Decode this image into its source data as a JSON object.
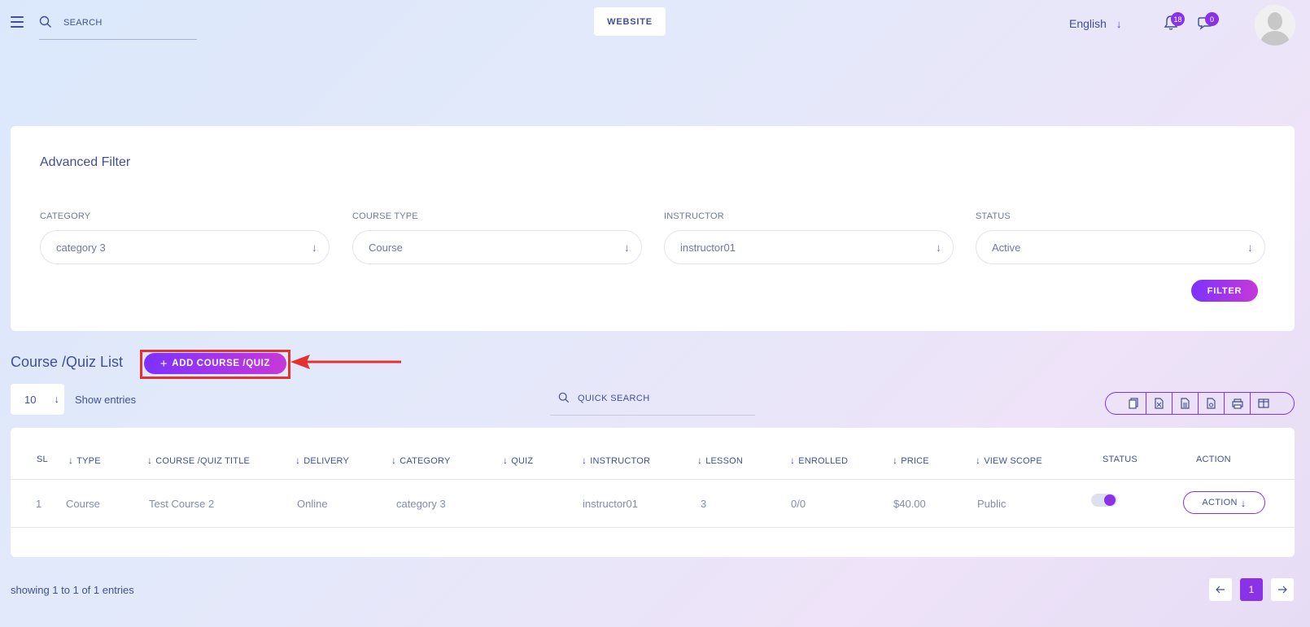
{
  "header": {
    "search_placeholder": "SEARCH",
    "website_label": "WEBSITE",
    "language": "English",
    "notification_count": "18",
    "message_count": "0"
  },
  "filter": {
    "title": "Advanced Filter",
    "fields": [
      {
        "label": "CATEGORY",
        "value": "category 3"
      },
      {
        "label": "COURSE TYPE",
        "value": "Course"
      },
      {
        "label": "INSTRUCTOR",
        "value": "instructor01"
      },
      {
        "label": "STATUS",
        "value": "Active"
      }
    ],
    "button_label": "FILTER"
  },
  "list": {
    "title": "Course /Quiz List",
    "add_label": "ADD COURSE /QUIZ",
    "entries_value": "10",
    "show_entries_label": "Show entries",
    "quick_search_label": "QUICK SEARCH"
  },
  "table": {
    "columns": [
      "SL",
      "TYPE",
      "COURSE /QUIZ TITLE",
      "DELIVERY",
      "CATEGORY",
      "QUIZ",
      "INSTRUCTOR",
      "LESSON",
      "ENROLLED",
      "PRICE",
      "VIEW SCOPE",
      "STATUS",
      "ACTION"
    ],
    "rows": [
      {
        "sl": "1",
        "type": "Course",
        "title": "Test Course 2",
        "delivery": "Online",
        "category": "category 3",
        "quiz": "",
        "instructor": "instructor01",
        "lesson": "3",
        "enrolled": "0/0",
        "price": "$40.00",
        "view_scope": "Public",
        "status_on": true,
        "action_label": "ACTION"
      }
    ]
  },
  "footer": {
    "showing_text": "showing 1 to 1 of 1 entries",
    "current_page": "1"
  },
  "colors": {
    "primary": "#415094",
    "accent": "#8b31e8",
    "highlight": "#e63131"
  }
}
